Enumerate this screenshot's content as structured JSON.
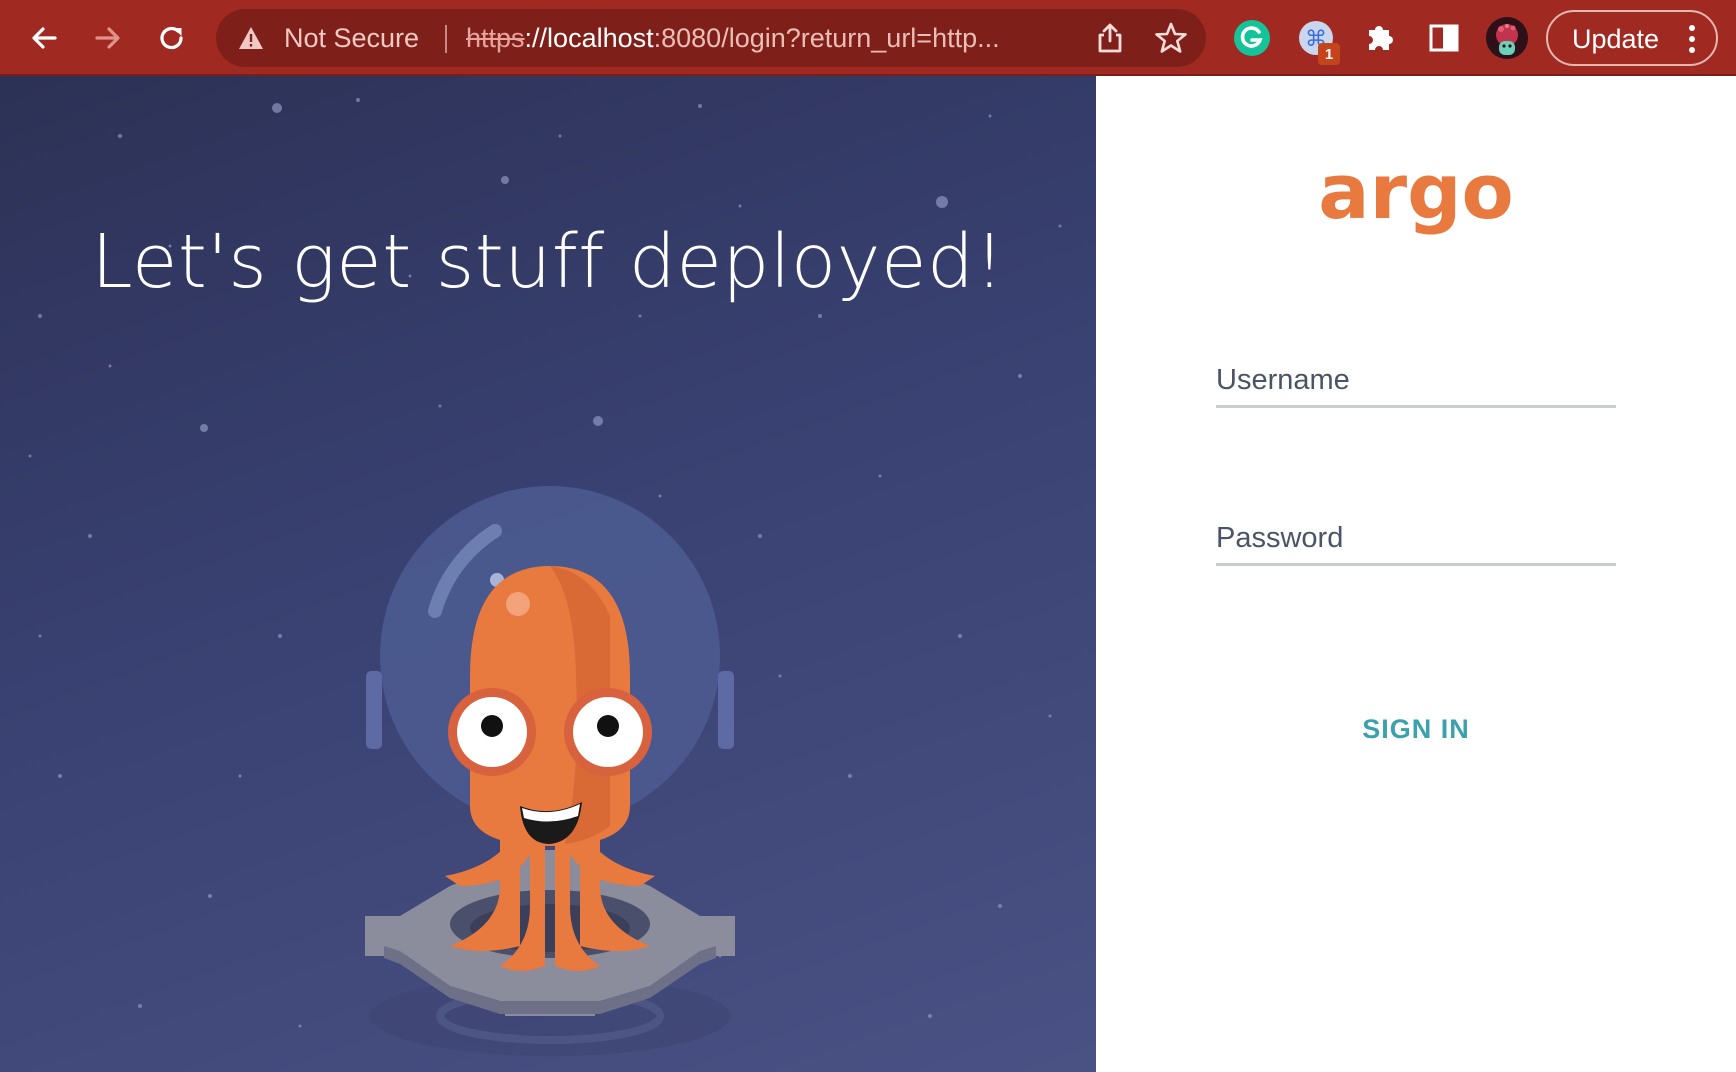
{
  "browser": {
    "security_label": "Not Secure",
    "url_scheme": "https",
    "url_host": "://localhost",
    "url_rest": ":8080/login?return_url=http...",
    "extension_badge": "1",
    "update_label": "Update"
  },
  "hero": {
    "headline": "Let's get stuff deployed!"
  },
  "login": {
    "logo_text": "argo",
    "username_label": "Username",
    "password_label": "Password",
    "sign_in_label": "SIGN IN"
  },
  "colors": {
    "toolbar": "#a02a22",
    "hero_background": "#394172",
    "brand_orange": "#e8793f",
    "sign_in_teal": "#3aa2ad"
  },
  "icons": [
    "back-arrow-icon",
    "forward-arrow-icon",
    "reload-icon",
    "warning-triangle-icon",
    "share-icon",
    "bookmark-star-icon",
    "grammarly-icon",
    "shortcut-extension-icon",
    "puzzle-extensions-icon",
    "side-panel-icon",
    "profile-avatar",
    "kebab-menu-icon"
  ]
}
